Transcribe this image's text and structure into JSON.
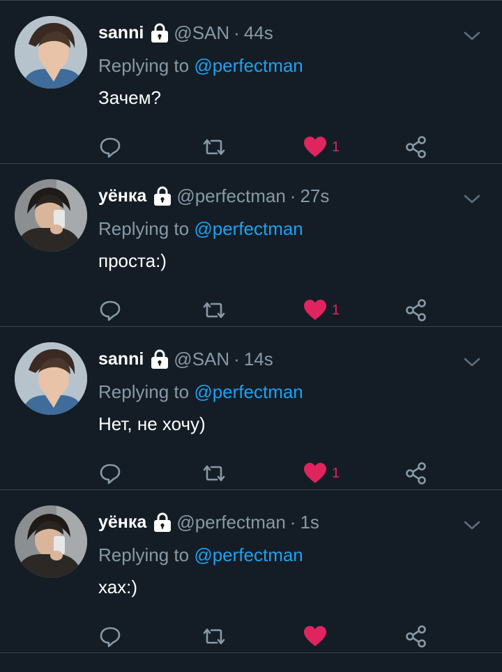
{
  "colors": {
    "background": "#141d26",
    "divider": "#38444d",
    "muted_text": "#8899a6",
    "mention": "#1da1f2",
    "like_active": "#e0245e",
    "primary_text": "#ffffff"
  },
  "tweets": [
    {
      "display_name": "sanni",
      "handle": "@SAN",
      "separator": "·",
      "time": "44s",
      "reply_label": "Replying to",
      "reply_mention": "@perfectman",
      "text": "Зачем?",
      "like_count": "1",
      "avatar_icon": "user-avatar-icon",
      "liked": true
    },
    {
      "display_name": "уёнка",
      "handle": "@perfectman",
      "separator": "·",
      "time": "27s",
      "reply_label": "Replying to",
      "reply_mention": "@perfectman",
      "text": "проста:)",
      "like_count": "1",
      "avatar_icon": "user-avatar-icon",
      "liked": true
    },
    {
      "display_name": "sanni",
      "handle": "@SAN",
      "separator": "·",
      "time": "14s",
      "reply_label": "Replying to",
      "reply_mention": "@perfectman",
      "text": "Нет, не хочу)",
      "like_count": "1",
      "avatar_icon": "user-avatar-icon",
      "liked": true
    },
    {
      "display_name": "уёнка",
      "handle": "@perfectman",
      "separator": "·",
      "time": "1s",
      "reply_label": "Replying to",
      "reply_mention": "@perfectman",
      "text": "хах:)",
      "like_count": "",
      "avatar_icon": "user-avatar-icon",
      "liked": true
    }
  ],
  "icons": {
    "lock": "lock-icon",
    "caret": "chevron-down-icon",
    "reply": "reply-icon",
    "retweet": "retweet-icon",
    "like": "heart-icon",
    "share": "share-icon"
  }
}
